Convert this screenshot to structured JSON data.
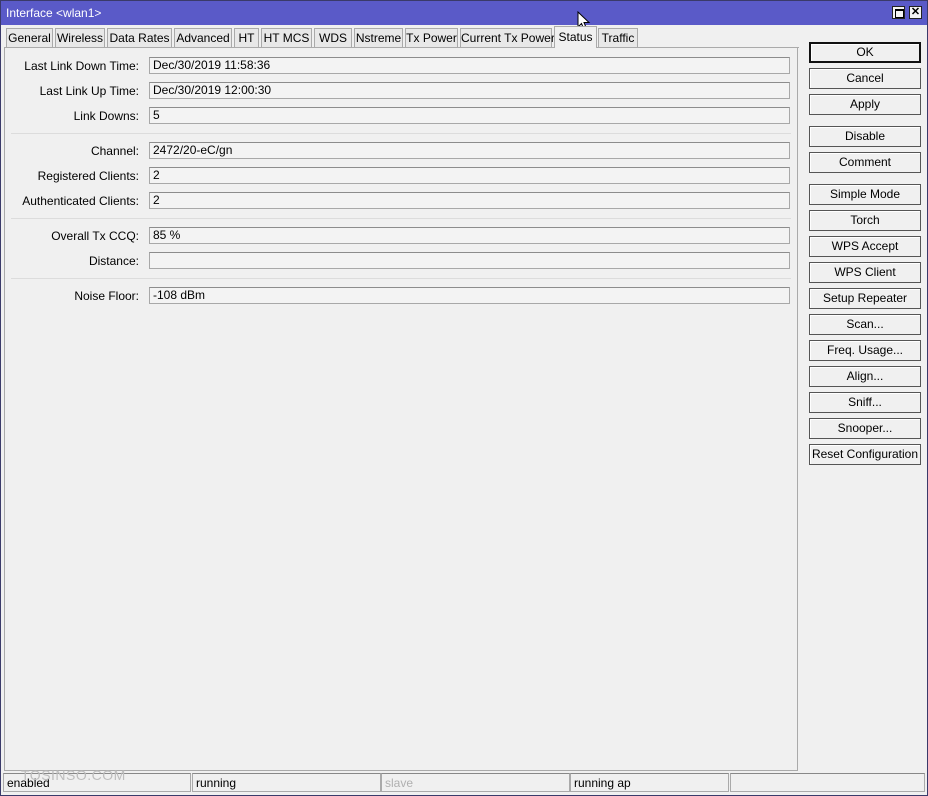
{
  "window": {
    "title": "Interface <wlan1>"
  },
  "tabs": [
    {
      "label": "General"
    },
    {
      "label": "Wireless"
    },
    {
      "label": "Data Rates"
    },
    {
      "label": "Advanced"
    },
    {
      "label": "HT"
    },
    {
      "label": "HT MCS"
    },
    {
      "label": "WDS"
    },
    {
      "label": "Nstreme"
    },
    {
      "label": "Tx Power"
    },
    {
      "label": "Current Tx Power"
    },
    {
      "label": "Status",
      "active": true
    },
    {
      "label": "Traffic"
    }
  ],
  "fields": {
    "last_link_down_time": {
      "label": "Last Link Down Time:",
      "value": "Dec/30/2019 11:58:36"
    },
    "last_link_up_time": {
      "label": "Last Link Up Time:",
      "value": "Dec/30/2019 12:00:30"
    },
    "link_downs": {
      "label": "Link Downs:",
      "value": "5"
    },
    "channel": {
      "label": "Channel:",
      "value": "2472/20-eC/gn"
    },
    "registered_clients": {
      "label": "Registered Clients:",
      "value": "2"
    },
    "authenticated_clients": {
      "label": "Authenticated Clients:",
      "value": "2"
    },
    "overall_tx_ccq": {
      "label": "Overall Tx CCQ:",
      "value": "85 %"
    },
    "distance": {
      "label": "Distance:",
      "value": ""
    },
    "noise_floor": {
      "label": "Noise Floor:",
      "value": "-108 dBm"
    }
  },
  "buttons": {
    "ok": "OK",
    "cancel": "Cancel",
    "apply": "Apply",
    "disable": "Disable",
    "comment": "Comment",
    "simple_mode": "Simple Mode",
    "torch": "Torch",
    "wps_accept": "WPS Accept",
    "wps_client": "WPS Client",
    "setup_repeater": "Setup Repeater",
    "scan": "Scan...",
    "freq_usage": "Freq. Usage...",
    "align": "Align...",
    "sniff": "Sniff...",
    "snooper": "Snooper...",
    "reset_configuration": "Reset Configuration"
  },
  "statusbar": {
    "enabled": "enabled",
    "running": "running",
    "slave": "slave",
    "running_ap": "running ap",
    "empty": ""
  },
  "watermark": "TOSINSO.COM",
  "colors": {
    "titlebar": "#5a5ac8",
    "window_bg": "#f0f0f0"
  }
}
